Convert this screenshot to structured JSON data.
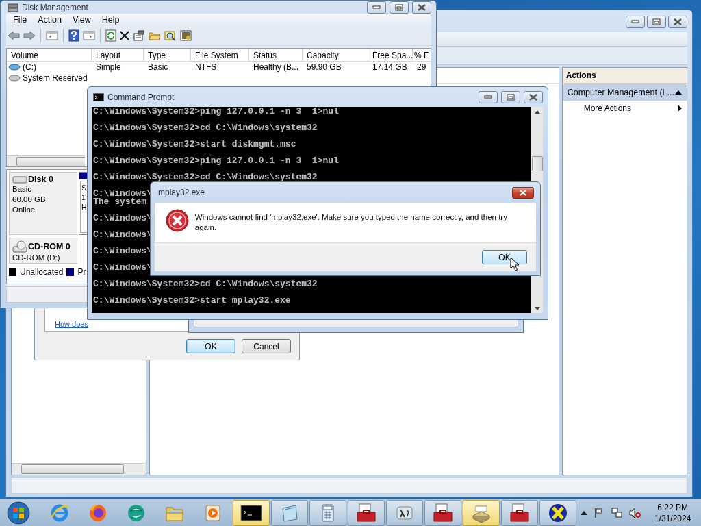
{
  "computer_management": {
    "actions_title": "Actions",
    "actions": [
      {
        "label": "Computer Management (L...",
        "kind": "section"
      },
      {
        "label": "More Actions",
        "kind": "submenu"
      }
    ]
  },
  "disk_cleanup_dialog": {
    "link": "How does",
    "buttons": [
      {
        "label": "OK",
        "default": true
      },
      {
        "label": "Cancel",
        "default": false
      }
    ]
  },
  "disk_management": {
    "title": "Disk Management",
    "menu": [
      "File",
      "Action",
      "View",
      "Help"
    ],
    "columns": [
      "Volume",
      "Layout",
      "Type",
      "File System",
      "Status",
      "Capacity",
      "Free Spa...",
      "% F"
    ],
    "rows": [
      {
        "kind": "basic",
        "cells": [
          "(C:)",
          "Simple",
          "Basic",
          "NTFS",
          "Healthy (B...",
          "59.90 GB",
          "17.14 GB",
          "29"
        ]
      },
      {
        "kind": "system",
        "cells": [
          "System Reserved"
        ]
      }
    ],
    "disks": [
      {
        "kind": "disk",
        "name": "Disk 0",
        "lines": [
          "Basic",
          "60.00 GB",
          "Online"
        ],
        "partition_lines": [
          "S",
          "1",
          "H"
        ]
      },
      {
        "kind": "cdrom",
        "name": "CD-ROM 0",
        "lines": [
          "CD-ROM (D:)"
        ]
      }
    ],
    "legend": [
      {
        "label": "Unallocated",
        "color": "#000000"
      },
      {
        "label": "Pr",
        "color": "#000080"
      }
    ]
  },
  "command_prompt": {
    "title": "Command Prompt",
    "blocks": [
      [
        "C:\\Windows\\System32>ping 127.0.0.1 -n 3  1>nul"
      ],
      [
        "C:\\Windows\\System32>cd C:\\Windows\\system32"
      ],
      [
        "C:\\Windows\\System32>start diskmgmt.msc"
      ],
      [
        "C:\\Windows\\System32>ping 127.0.0.1 -n 3  1>nul"
      ],
      [
        "C:\\Windows\\System32>cd C:\\Windows\\system32"
      ],
      [
        "C:\\Windows\\",
        "The system"
      ],
      [
        "C:\\Windows\\"
      ],
      [
        "C:\\Windows\\"
      ],
      [
        "C:\\Windows\\"
      ],
      [
        "C:\\Windows\\"
      ],
      [
        "C:\\Windows\\System32>cd C:\\Windows\\system32"
      ],
      [
        "C:\\Windows\\System32>start mplay32.exe"
      ]
    ]
  },
  "error_dialog": {
    "title": "mplay32.exe",
    "message": "Windows cannot find 'mplay32.exe'. Make sure you typed the name correctly, and then try again.",
    "button": "OK"
  },
  "taskbar": {
    "apps": [
      {
        "kind": "ie",
        "running": false,
        "highlighted": false
      },
      {
        "kind": "firefox",
        "running": false,
        "highlighted": false
      },
      {
        "kind": "globe",
        "running": false,
        "highlighted": false
      },
      {
        "kind": "folder",
        "running": false,
        "highlighted": false
      },
      {
        "kind": "media",
        "running": false,
        "highlighted": false
      },
      {
        "kind": "console",
        "running": true,
        "highlighted": true
      },
      {
        "kind": "notepad",
        "running": true,
        "highlighted": false
      },
      {
        "kind": "calculator",
        "running": true,
        "highlighted": false
      },
      {
        "kind": "toolbox",
        "running": true,
        "highlighted": false
      },
      {
        "kind": "lambda",
        "running": true,
        "highlighted": false
      },
      {
        "kind": "toolbox",
        "running": true,
        "highlighted": false
      },
      {
        "kind": "scanner",
        "running": true,
        "highlighted": true
      },
      {
        "kind": "toolbox",
        "running": true,
        "highlighted": false
      },
      {
        "kind": "xming",
        "running": true,
        "highlighted": false
      }
    ],
    "clock": {
      "time": "6:22 PM",
      "date": "1/31/2024"
    }
  }
}
